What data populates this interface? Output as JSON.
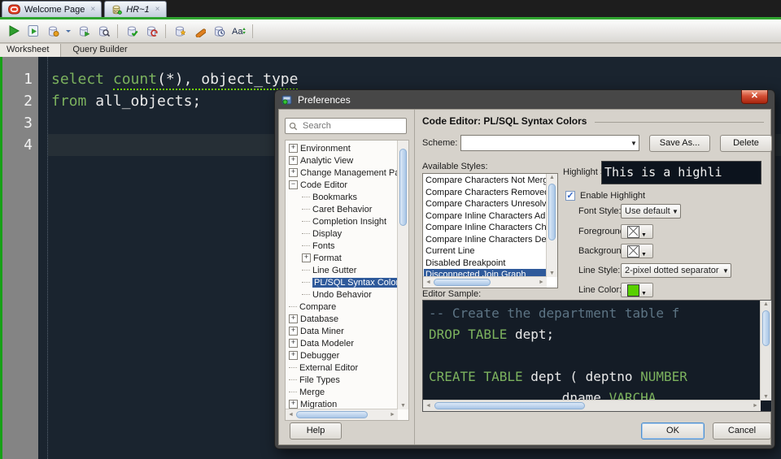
{
  "window": {
    "tabs": [
      {
        "label": "Welcome Page"
      },
      {
        "label": "HR~1"
      }
    ]
  },
  "toolbar": {
    "icons": [
      "run-statement",
      "run-script",
      "autotrace",
      "autotrace-caret",
      "explain-plan",
      "find-db",
      "sep",
      "commit",
      "rollback",
      "sep",
      "unshared-worksheet",
      "clear",
      "sql-history",
      "change-case",
      "sep"
    ]
  },
  "worksheet_bar": {
    "tabs": [
      "Worksheet",
      "Query Builder"
    ]
  },
  "editor": {
    "gutter": [
      "1",
      "2",
      "3",
      "4"
    ],
    "lines": [
      [
        {
          "t": "select",
          "c": "kw"
        },
        {
          "t": " "
        },
        {
          "c": "ul",
          "g": [
            {
              "t": "count",
              "c": "kw"
            },
            {
              "t": "(*), object_type"
            }
          ]
        }
      ],
      [
        {
          "t": "from",
          "c": "kw"
        },
        {
          "t": " all_objects;"
        }
      ],
      [],
      []
    ]
  },
  "dialog": {
    "title": "Preferences",
    "search_placeholder": "Search",
    "tree": [
      {
        "label": "Environment",
        "exp": "+"
      },
      {
        "label": "Analytic View",
        "exp": "+"
      },
      {
        "label": "Change Management Parar",
        "exp": "+"
      },
      {
        "label": "Code Editor",
        "exp": "-"
      },
      {
        "label": "Bookmarks",
        "depth": 1
      },
      {
        "label": "Caret Behavior",
        "depth": 1
      },
      {
        "label": "Completion Insight",
        "depth": 1
      },
      {
        "label": "Display",
        "depth": 1
      },
      {
        "label": "Fonts",
        "depth": 1
      },
      {
        "label": "Format",
        "depth": 1,
        "exp": "+"
      },
      {
        "label": "Line Gutter",
        "depth": 1
      },
      {
        "label": "PL/SQL Syntax Colors",
        "depth": 1,
        "selected": true
      },
      {
        "label": "Undo Behavior",
        "depth": 1
      },
      {
        "label": "Compare"
      },
      {
        "label": "Database",
        "exp": "+"
      },
      {
        "label": "Data Miner",
        "exp": "+"
      },
      {
        "label": "Data Modeler",
        "exp": "+"
      },
      {
        "label": "Debugger",
        "exp": "+"
      },
      {
        "label": "External Editor"
      },
      {
        "label": "File Types"
      },
      {
        "label": "Merge"
      },
      {
        "label": "Migration",
        "exp": "+"
      }
    ],
    "panel_title": "Code Editor: PL/SQL Syntax Colors",
    "scheme_label": "Scheme:",
    "scheme_value": "",
    "save_as_label": "Save As...",
    "delete_label": "Delete",
    "available_styles_label": "Available Styles:",
    "styles": [
      "Compare Characters Not Merg",
      "Compare Characters Removed",
      "Compare Characters Unresolve",
      "Compare Inline Characters Ad",
      "Compare Inline Characters Ch",
      "Compare Inline Characters Del",
      "Current Line",
      "Disabled Breakpoint",
      "Disconnected Join Graph"
    ],
    "selected_style_index": 8,
    "highlight_sample_label": "Highlight Sample:",
    "highlight_sample_text": "This is a highli",
    "enable_highlight_label": "Enable Highlight",
    "font_style_label": "Font Style:",
    "font_style_value": "Use default",
    "foreground_label": "Foreground:",
    "background_label": "Background:",
    "line_style_label": "Line Style:",
    "line_style_value": "2-pixel dotted separator",
    "line_color_label": "Line Color:",
    "line_color_value": "#58d000",
    "editor_sample_label": "Editor Sample:",
    "sample_lines": [
      [
        {
          "t": "-- Create the department table f",
          "c": "cm"
        }
      ],
      [
        {
          "t": "DROP TABLE",
          "c": "kw"
        },
        {
          "t": " dept;"
        }
      ],
      [],
      [
        {
          "t": "CREATE TABLE",
          "c": "kw"
        },
        {
          "t": " dept ( deptno ",
          "c": ""
        },
        {
          "t": "NUMBER",
          "c": "kw"
        }
      ],
      [
        {
          "t": "                 dname ",
          "c": ""
        },
        {
          "t": "VARCHA",
          "c": "kw"
        }
      ]
    ],
    "help_label": "Help",
    "ok_label": "OK",
    "cancel_label": "Cancel",
    "colors": {
      "selection_blue": "#2f5a9b",
      "keyword_green": "#7cb25e",
      "underline_green": "#6fd400",
      "comment_gray": "#5d7484",
      "editor_bg": "#1a242f",
      "gutter_gray": "#848484",
      "accent_green_bar": "#17a017"
    }
  }
}
